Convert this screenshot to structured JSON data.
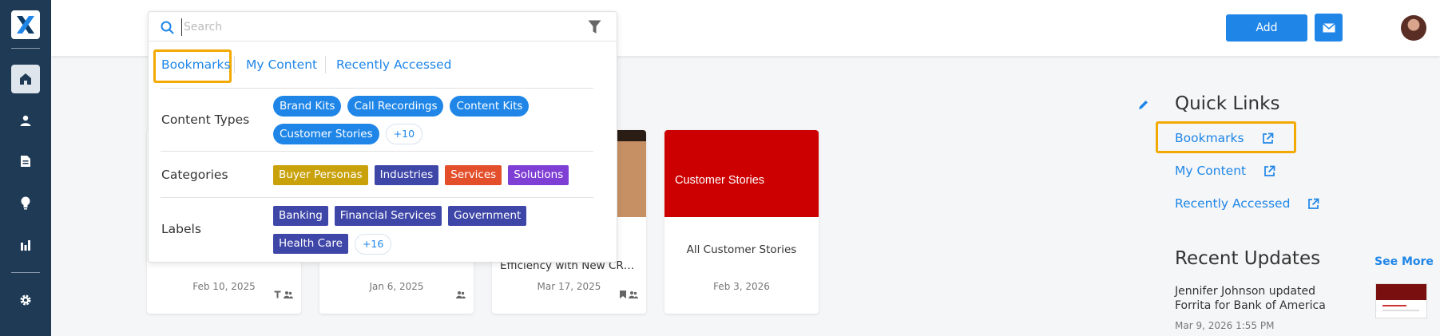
{
  "header": {
    "add_label": "Add",
    "mail_icon": "mail-icon",
    "avatar_icon": "user-avatar"
  },
  "sidebar": {
    "items": [
      {
        "name": "home",
        "icon": "home-icon",
        "active": true
      },
      {
        "name": "users",
        "icon": "user-icon",
        "active": false
      },
      {
        "name": "content",
        "icon": "document-icon",
        "active": false
      },
      {
        "name": "ideas",
        "icon": "lightbulb-icon",
        "active": false
      },
      {
        "name": "analytics",
        "icon": "bar-chart-icon",
        "active": false
      },
      {
        "name": "settings",
        "icon": "gear-icon",
        "active": false
      }
    ]
  },
  "search": {
    "placeholder": "Search",
    "value": "",
    "tabs": [
      "Bookmarks",
      "My Content",
      "Recently Accessed"
    ],
    "selected_tab": "Bookmarks",
    "content_types": {
      "label": "Content Types",
      "chips": [
        "Brand Kits",
        "Call Recordings",
        "Content Kits",
        "Customer Stories"
      ],
      "more": "+10"
    },
    "categories": {
      "label": "Categories",
      "chips": [
        {
          "text": "Buyer Personas",
          "color": "#c9a10b"
        },
        {
          "text": "Industries",
          "color": "#3e46a8"
        },
        {
          "text": "Services",
          "color": "#e44f2b"
        },
        {
          "text": "Solutions",
          "color": "#7f3fd4"
        }
      ]
    },
    "labels": {
      "label": "Labels",
      "chips": [
        "Banking",
        "Financial Services",
        "Government",
        "Health Care"
      ],
      "chip_color": "#3e46a8",
      "more": "+16"
    }
  },
  "cards": [
    {
      "title": "",
      "date": "Feb 10, 2025",
      "icons": [
        "text-icon",
        "group-icon"
      ]
    },
    {
      "title": "",
      "date": "Jan 6, 2025",
      "icons": [
        "group-icon"
      ]
    },
    {
      "title": "Efficiency with New CRM...",
      "date": "Mar 17, 2025",
      "icons": [
        "bookmark-icon",
        "group-icon"
      ]
    },
    {
      "title": "All Customer Stories",
      "image_text": "Customer Stories",
      "date": "Feb 3, 2026",
      "icons": []
    }
  ],
  "quick_links": {
    "title": "Quick Links",
    "links": [
      "Bookmarks",
      "My Content",
      "Recently Accessed"
    ]
  },
  "recent_updates": {
    "title": "Recent Updates",
    "see_more": "See More",
    "items": [
      {
        "text": "Jennifer Johnson updated Forrita for Bank of America",
        "date": "Mar 9, 2026 1:55 PM"
      }
    ]
  },
  "colors": {
    "sidebar": "#1e3a55",
    "accent": "#1f86e8",
    "highlight": "#f2a900",
    "card_red": "#cc0000"
  }
}
